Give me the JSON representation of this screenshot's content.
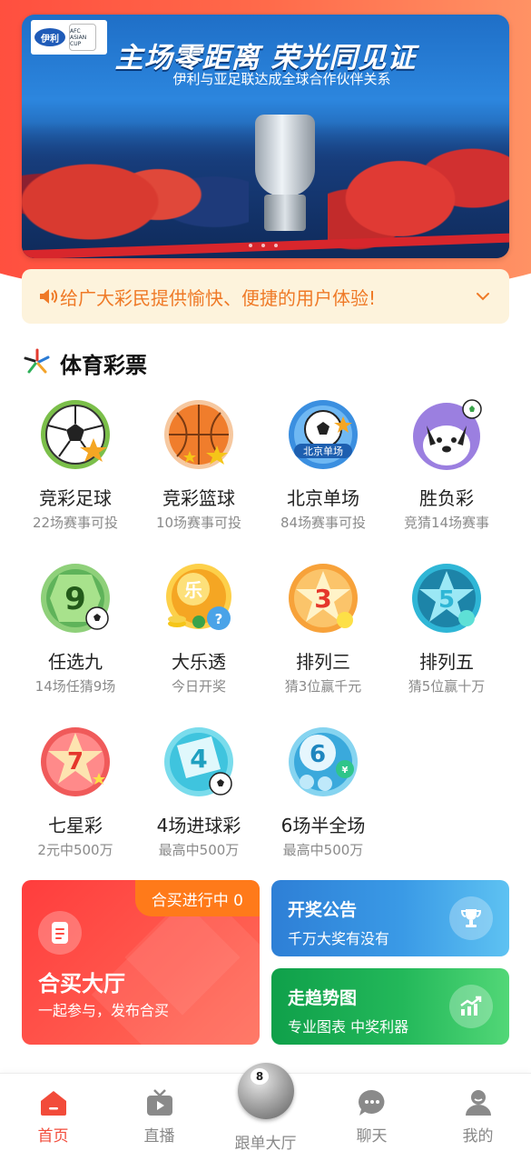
{
  "banner": {
    "headline": "主场零距离 荣光同见证",
    "subline": "伊利与亚足联达成全球合作伙伴关系",
    "logo_yili": "伊利",
    "logo_afc": "AFC ASIAN CUP"
  },
  "notice": {
    "text": "给广大彩民提供愉快、便捷的用户体验!"
  },
  "section": {
    "title": "体育彩票"
  },
  "lotteries": [
    {
      "name": "竞彩足球",
      "desc": "22场赛事可投",
      "icon": "football-icon",
      "color": "#7bbf4a"
    },
    {
      "name": "竞彩篮球",
      "desc": "10场赛事可投",
      "icon": "basketball-icon",
      "color": "#f08a3c"
    },
    {
      "name": "北京单场",
      "desc": "84场赛事可投",
      "icon": "beijing-single-icon",
      "color": "#3b8fe0"
    },
    {
      "name": "胜负彩",
      "desc": "竞猜14场赛事",
      "icon": "win-lose-icon",
      "color": "#9b7fe0"
    },
    {
      "name": "任选九",
      "desc": "14场任猜9场",
      "icon": "pick-nine-icon",
      "color": "#5fb35a"
    },
    {
      "name": "大乐透",
      "desc": "今日开奖",
      "icon": "lotto-icon",
      "color": "#f5a623"
    },
    {
      "name": "排列三",
      "desc": "猜3位赢千元",
      "icon": "arrange-three-icon",
      "color": "#f7a23a"
    },
    {
      "name": "排列五",
      "desc": "猜5位赢十万",
      "icon": "arrange-five-icon",
      "color": "#2fb6d6"
    },
    {
      "name": "七星彩",
      "desc": "2元中500万",
      "icon": "seven-star-icon",
      "color": "#f05a5a"
    },
    {
      "name": "4场进球彩",
      "desc": "最高中500万",
      "icon": "four-goals-icon",
      "color": "#3fc4de"
    },
    {
      "name": "6场半全场",
      "desc": "最高中500万",
      "icon": "six-half-icon",
      "color": "#3aa9dc"
    }
  ],
  "cards": {
    "hemai": {
      "badge": "合买进行中 0",
      "title": "合买大厅",
      "desc": "一起参与，发布合买"
    },
    "kaijiang": {
      "title": "开奖公告",
      "desc": "千万大奖有没有"
    },
    "zoushi": {
      "title": "走趋势图",
      "desc": "专业图表 中奖利器"
    }
  },
  "tabs": [
    {
      "label": "首页"
    },
    {
      "label": "直播"
    },
    {
      "label": "跟单大厅"
    },
    {
      "label": "聊天"
    },
    {
      "label": "我的"
    }
  ],
  "colors": {
    "accent": "#f24b3a",
    "notice_text": "#ef7a27",
    "notice_bg": "#fdf3dc"
  }
}
